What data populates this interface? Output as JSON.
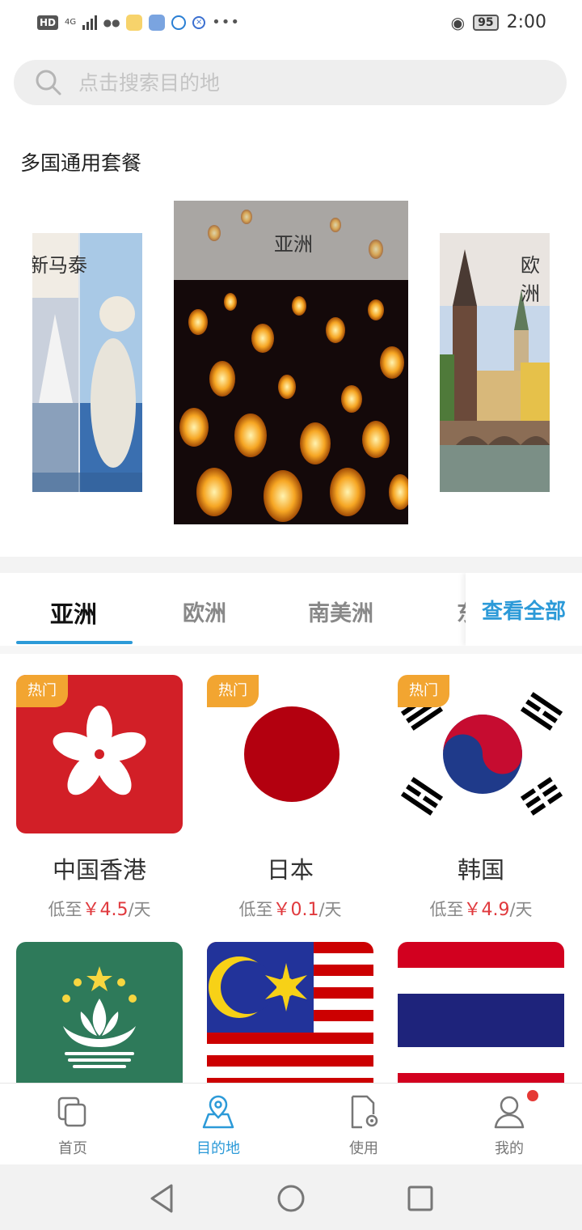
{
  "status_bar": {
    "network_badge": "HD",
    "network_type": "4G",
    "battery": "95",
    "time": "2:00"
  },
  "search": {
    "placeholder": "点击搜索目的地"
  },
  "section": {
    "title": "多国通用套餐"
  },
  "carousel": [
    {
      "label": "新马泰"
    },
    {
      "label": "亚洲"
    },
    {
      "label": "欧洲"
    }
  ],
  "tabs": {
    "items": [
      {
        "label": "亚洲",
        "active": true
      },
      {
        "label": "欧洲",
        "active": false
      },
      {
        "label": "南美洲",
        "active": false
      }
    ],
    "view_all": "查看全部"
  },
  "destinations": [
    {
      "name": "中国香港",
      "hot": "热门",
      "price_prefix": "低至",
      "price": "￥4.5",
      "price_suffix": "/天"
    },
    {
      "name": "日本",
      "hot": "热门",
      "price_prefix": "低至",
      "price": "￥0.1",
      "price_suffix": "/天"
    },
    {
      "name": "韩国",
      "hot": "热门",
      "price_prefix": "低至",
      "price": "￥4.9",
      "price_suffix": "/天"
    }
  ],
  "bottom_nav": [
    {
      "label": "首页",
      "icon": "home-icon",
      "active": false
    },
    {
      "label": "目的地",
      "icon": "map-pin-icon",
      "active": true
    },
    {
      "label": "使用",
      "icon": "settings-doc-icon",
      "active": false
    },
    {
      "label": "我的",
      "icon": "user-icon",
      "active": false
    }
  ],
  "colors": {
    "accent": "#2c9ad8",
    "hot_badge": "#f2a531",
    "price": "#e0393d"
  }
}
